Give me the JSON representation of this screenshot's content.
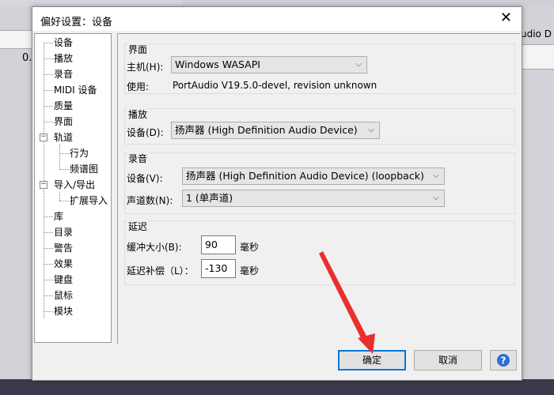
{
  "background": {
    "left_text": "0.",
    "right_text": "udio D"
  },
  "dialog": {
    "title": "偏好设置：设备",
    "close_glyph": "✕"
  },
  "tree": {
    "items": [
      {
        "label": "设备"
      },
      {
        "label": "播放"
      },
      {
        "label": "录音"
      },
      {
        "label": "MIDI 设备"
      },
      {
        "label": "质量"
      },
      {
        "label": "界面"
      },
      {
        "label": "轨道"
      },
      {
        "label": "行为"
      },
      {
        "label": "频谱图"
      },
      {
        "label": "导入/导出"
      },
      {
        "label": "扩展导入"
      },
      {
        "label": "库"
      },
      {
        "label": "目录"
      },
      {
        "label": "警告"
      },
      {
        "label": "效果"
      },
      {
        "label": "键盘"
      },
      {
        "label": "鼠标"
      },
      {
        "label": "模块"
      }
    ],
    "expander_glyph": "−"
  },
  "interface": {
    "title": "界面",
    "host_label": "主机(H):",
    "host_value": "Windows WASAPI",
    "using_label": "使用:",
    "using_value": "PortAudio V19.5.0-devel, revision unknown"
  },
  "playback": {
    "title": "播放",
    "device_label": "设备(D):",
    "device_value": "扬声器 (High Definition Audio Device)"
  },
  "recording": {
    "title": "录音",
    "device_label": "设备(V):",
    "device_value": "扬声器 (High Definition Audio Device) (loopback)",
    "channels_label": "声道数(N):",
    "channels_value": "1 (单声道)"
  },
  "latency": {
    "title": "延迟",
    "buffer_label": "缓冲大小(B):",
    "buffer_value": "90",
    "buffer_unit": "毫秒",
    "comp_label": "延迟补偿（L）：",
    "comp_value": "-130",
    "comp_unit": "毫秒"
  },
  "buttons": {
    "ok": "确定",
    "cancel": "取消"
  },
  "chevron_glyph": "⌵",
  "colors": {
    "accent": "#0078d7",
    "arrow": "#e8302c"
  }
}
